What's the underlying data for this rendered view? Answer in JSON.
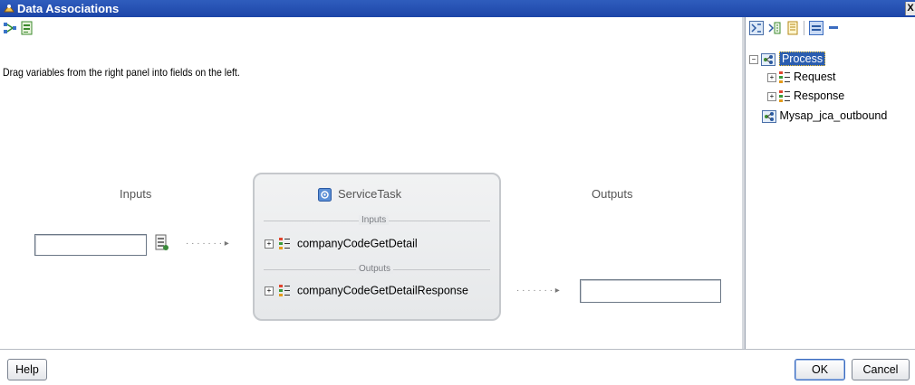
{
  "window": {
    "title": "Data Associations",
    "close_label": "X"
  },
  "left_panel": {
    "toolbar": [
      "map-icon",
      "variable-icon"
    ],
    "instruction": "Drag variables from the right panel into fields on the left.",
    "inputs_label": "Inputs",
    "outputs_label": "Outputs",
    "input_field_value": "",
    "output_field_value": "",
    "service": {
      "title": "ServiceTask",
      "inputs_section": "Inputs",
      "outputs_section": "Outputs",
      "input_item": "companyCodeGetDetail",
      "output_item": "companyCodeGetDetailResponse"
    }
  },
  "right_panel": {
    "toolbar": [
      "filter-icon",
      "expression-icon",
      "document-icon",
      "panel-icon",
      "collapse-icon"
    ],
    "tree": {
      "root": "Process",
      "children": [
        "Request",
        "Response"
      ],
      "sibling": "Mysap_jca_outbound"
    }
  },
  "footer": {
    "help_label": "Help",
    "ok_label": "OK",
    "cancel_label": "Cancel"
  },
  "colors": {
    "title_bar": "#1d46a8",
    "selection": "#2a5db0"
  }
}
